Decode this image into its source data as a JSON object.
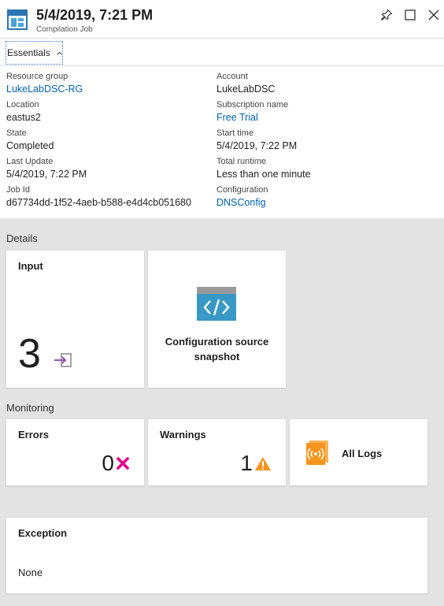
{
  "header": {
    "title": "5/4/2019, 7:21 PM",
    "subtitle": "Compilation Job",
    "icon": "compilation-job-icon",
    "actions": [
      "pin-icon",
      "maximize-icon",
      "close-icon"
    ]
  },
  "essentials": {
    "toggle_label": "Essentials",
    "left": [
      {
        "label": "Resource group",
        "value": "LukeLabDSC-RG",
        "link": true
      },
      {
        "label": "Location",
        "value": "eastus2",
        "link": false
      },
      {
        "label": "State",
        "value": "Completed",
        "link": false
      },
      {
        "label": "Last Update",
        "value": "5/4/2019, 7:22 PM",
        "link": false
      },
      {
        "label": "Job Id",
        "value": "d67734dd-1f52-4aeb-b588-e4d4cb051680",
        "link": false
      }
    ],
    "right": [
      {
        "label": "Account",
        "value": "LukeLabDSC",
        "link": false
      },
      {
        "label": "Subscription name",
        "value": "Free Trial",
        "link": true
      },
      {
        "label": "Start time",
        "value": "5/4/2019, 7:22 PM",
        "link": false
      },
      {
        "label": "Total runtime",
        "value": "Less than one minute",
        "link": false
      },
      {
        "label": "Configuration",
        "value": "DNSConfig",
        "link": true
      }
    ]
  },
  "details": {
    "section_title": "Details",
    "input": {
      "title": "Input",
      "count": "3"
    },
    "snapshot": {
      "label_line1": "Configuration source",
      "label_line2": "snapshot"
    }
  },
  "monitoring": {
    "section_title": "Monitoring",
    "errors": {
      "title": "Errors",
      "count": "0"
    },
    "warnings": {
      "title": "Warnings",
      "count": "1"
    },
    "logs": {
      "label": "All Logs"
    }
  },
  "exception": {
    "title": "Exception",
    "value": "None"
  },
  "colors": {
    "link": "#0063b1",
    "error": "#e3008c",
    "warning": "#f7941d",
    "logs": "#f7941d",
    "snapshot": "#3999c6"
  }
}
